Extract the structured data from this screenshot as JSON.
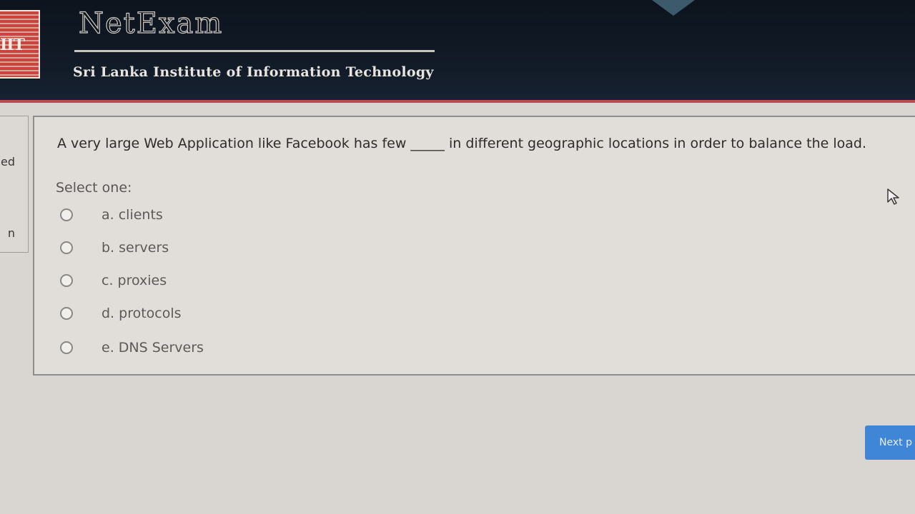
{
  "header": {
    "logo_text": "IIT",
    "brand": "NetExam",
    "institute": "Sri Lanka Institute of Information Technology"
  },
  "nav_stub": {
    "fragment_top": "ed",
    "fragment_bottom": "n"
  },
  "question": {
    "text": "A very large Web Application like Facebook  has few _____ in different geographic locations in order to balance the load.",
    "select_label": "Select one:",
    "options": [
      {
        "label": "a. clients",
        "selected": false
      },
      {
        "label": "b. servers",
        "selected": false
      },
      {
        "label": "c. proxies",
        "selected": false
      },
      {
        "label": "d. protocols",
        "selected": false
      },
      {
        "label": "e. DNS Servers",
        "selected": false
      }
    ]
  },
  "navigation": {
    "next_label": "Next p"
  },
  "colors": {
    "header_bg": "#111a26",
    "accent_rule": "#b84c4a",
    "card_bg": "#e1deda",
    "next_button": "#3f86d6"
  },
  "icons": {
    "cursor": "mouse-pointer-icon",
    "logo": "sliit-logo"
  }
}
